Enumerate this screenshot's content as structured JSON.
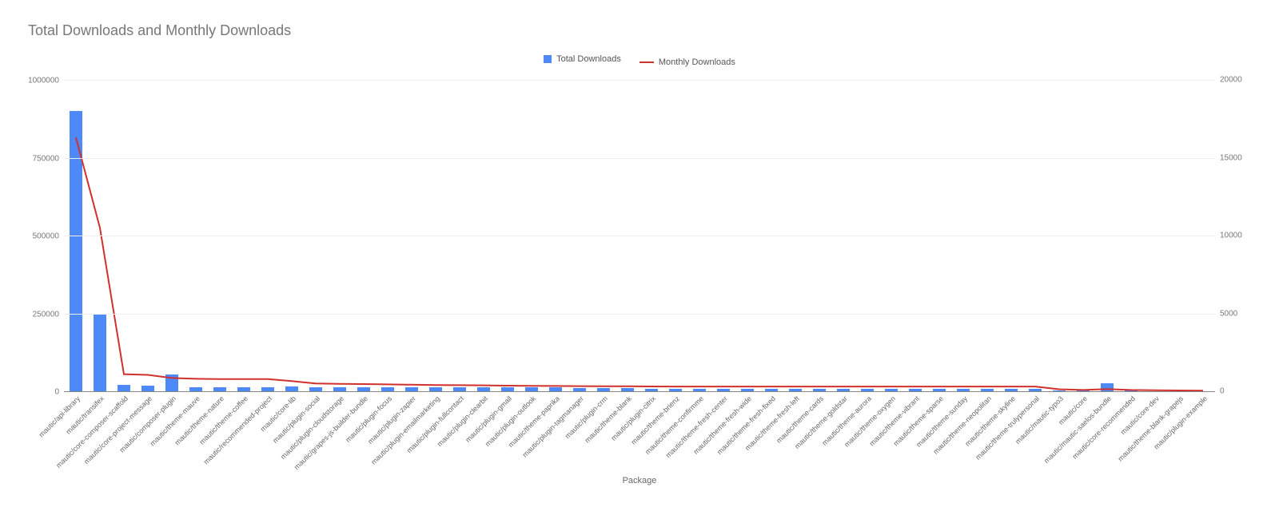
{
  "title": "Total Downloads and Monthly Downloads",
  "legend": {
    "series_a": "Total Downloads",
    "series_b": "Monthly Downloads"
  },
  "axes": {
    "x_title": "Package",
    "y_left_ticks": [
      0,
      250000,
      500000,
      750000,
      1000000
    ],
    "y_right_ticks": [
      0,
      5000,
      10000,
      15000,
      20000
    ]
  },
  "chart_data": {
    "type": "bar",
    "title": "Total Downloads and Monthly Downloads",
    "xlabel": "Package",
    "ylabel": "",
    "ylim": [
      0,
      1000000
    ],
    "y2lim": [
      0,
      20000
    ],
    "categories": [
      "mautic/api-library",
      "mautic/transifex",
      "mautic/core-composer-scaffold",
      "mautic/core-project-message",
      "mautic/composer-plugin",
      "mautic/theme-mauve",
      "mautic/theme-nature",
      "mautic/theme-coffee",
      "mautic/recommended-project",
      "mautic/core-lib",
      "mautic/plugin-social",
      "mautic/plugin-cloudstorage",
      "mautic/grapes-js-builder-bundle",
      "mautic/plugin-focus",
      "mautic/plugin-zapier",
      "mautic/plugin-emailmarketing",
      "mautic/plugin-fullcontact",
      "mautic/plugin-clearbit",
      "mautic/plugin-gmail",
      "mautic/plugin-outlook",
      "mautic/theme-paprika",
      "mautic/plugin-tagmanager",
      "mautic/plugin-crm",
      "mautic/theme-blank",
      "mautic/plugin-citrix",
      "mautic/theme-brienz",
      "mautic/theme-confirmme",
      "mautic/theme-fresh-center",
      "mautic/theme-fresh-wide",
      "mautic/theme-fresh-fixed",
      "mautic/theme-fresh-left",
      "mautic/theme-cards",
      "mautic/theme-goldstar",
      "mautic/theme-aurora",
      "mautic/theme-oxygen",
      "mautic/theme-vibrant",
      "mautic/theme-sparse",
      "mautic/theme-sunday",
      "mautic/theme-neopolitan",
      "mautic/theme-skyline",
      "mautic/theme-trulypersonal",
      "mautic/mautic-typo3",
      "mautic/core",
      "mautic/mautic-saelos-bundle",
      "mautic/core-recommended",
      "mautic/core-dev",
      "mautic/theme-blank-grapejs",
      "mautic/plugin-example"
    ],
    "series": [
      {
        "name": "Total Downloads",
        "axis": "left",
        "kind": "bar",
        "color": "#4d89f9",
        "values": [
          900000,
          250000,
          20000,
          18000,
          55000,
          12000,
          12000,
          12000,
          12000,
          15000,
          12000,
          12000,
          12000,
          12000,
          12000,
          12000,
          12000,
          12000,
          12000,
          12000,
          12000,
          10000,
          10000,
          10000,
          8000,
          8000,
          8000,
          8000,
          8000,
          8000,
          8000,
          8000,
          8000,
          8000,
          8000,
          8000,
          8000,
          8000,
          8000,
          8000,
          8000,
          2000,
          3000,
          25000,
          2000,
          1000,
          1000,
          500
        ]
      },
      {
        "name": "Monthly Downloads",
        "axis": "right",
        "kind": "line",
        "color": "#d0312d",
        "values": [
          16300,
          10500,
          1100,
          1050,
          850,
          800,
          780,
          780,
          780,
          650,
          500,
          470,
          460,
          440,
          420,
          400,
          390,
          380,
          360,
          350,
          340,
          330,
          320,
          320,
          310,
          300,
          300,
          300,
          300,
          300,
          300,
          300,
          300,
          300,
          300,
          300,
          300,
          300,
          300,
          300,
          300,
          130,
          80,
          140,
          80,
          60,
          50,
          40
        ]
      }
    ]
  }
}
